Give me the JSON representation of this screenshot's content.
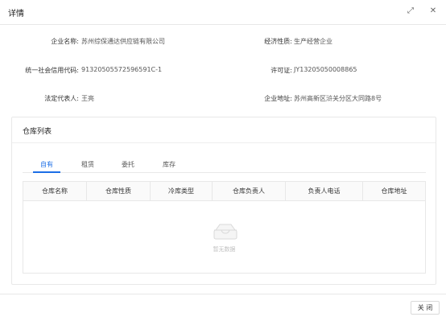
{
  "dialog": {
    "title": "详情",
    "fullscreen_icon": "⤢",
    "close_icon": "✕"
  },
  "info": {
    "company_name": {
      "label": "企业名称:",
      "value": "苏州综保通达供应链有限公司"
    },
    "economic_nature": {
      "label": "经济性质:",
      "value": "生产经营企业"
    },
    "credit_code": {
      "label": "统一社会信用代码:",
      "value": "91320505572596591C-1"
    },
    "license": {
      "label": "许可证:",
      "value": "JY13205050008865"
    },
    "legal_rep": {
      "label": "法定代表人:",
      "value": "王亮"
    },
    "address": {
      "label": "企业地址:",
      "value": "苏州高新区浒关分区大同路8号"
    }
  },
  "warehouse": {
    "title": "仓库列表",
    "tabs": [
      "自有",
      "租赁",
      "委托",
      "库存"
    ],
    "active_tab": 0,
    "columns": [
      "仓库名称",
      "仓库性质",
      "冷库类型",
      "仓库负责人",
      "负责人电话",
      "仓库地址"
    ],
    "rows": [],
    "empty_text": "暂无数据"
  },
  "footer": {
    "close_label": "关 闭"
  }
}
